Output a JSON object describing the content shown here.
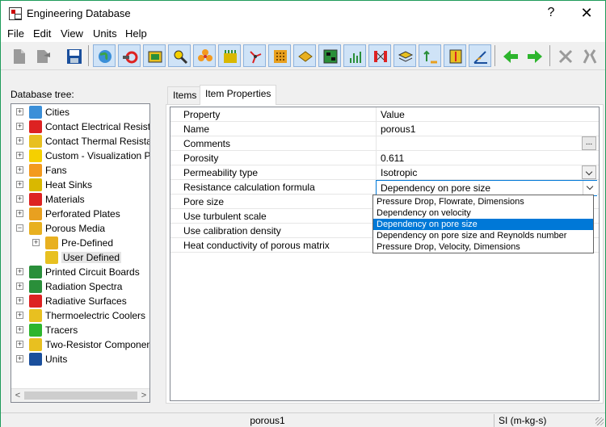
{
  "window": {
    "title": "Engineering Database",
    "help_glyph": "?",
    "close_glyph": "✕"
  },
  "menu": [
    "File",
    "Edit",
    "View",
    "Units",
    "Help"
  ],
  "toolbar_icons": [
    "new-document-icon",
    "open-document-icon",
    "save-icon",
    "globe-icon",
    "contact-electrical-icon",
    "contact-thermal-icon",
    "visualization-icon",
    "fan-icon",
    "heat-sink-icon",
    "materials-icon",
    "perforated-plate-icon",
    "porous-media-icon",
    "pcb-icon",
    "radiation-spectra-icon",
    "radiative-surface-icon",
    "thermoelectric-icon",
    "tracers-icon",
    "two-resistor-icon",
    "units-icon",
    "arrow-left-icon",
    "arrow-right-icon",
    "cut-icon",
    "tools-icon"
  ],
  "tree": {
    "label": "Database tree:",
    "items": [
      {
        "label": "Cities",
        "icon": "globe-icon",
        "level": 0,
        "expander": "+"
      },
      {
        "label": "Contact Electrical Resistan",
        "icon": "contact-electrical-icon",
        "level": 0,
        "expander": "+"
      },
      {
        "label": "Contact Thermal Resistanc",
        "icon": "contact-thermal-icon",
        "level": 0,
        "expander": "+"
      },
      {
        "label": "Custom - Visualization Para",
        "icon": "visualization-icon",
        "level": 0,
        "expander": "+"
      },
      {
        "label": "Fans",
        "icon": "fan-icon",
        "level": 0,
        "expander": "+"
      },
      {
        "label": "Heat Sinks",
        "icon": "heat-sink-icon",
        "level": 0,
        "expander": "+"
      },
      {
        "label": "Materials",
        "icon": "materials-icon",
        "level": 0,
        "expander": "+"
      },
      {
        "label": "Perforated Plates",
        "icon": "perforated-plate-icon",
        "level": 0,
        "expander": "+"
      },
      {
        "label": "Porous Media",
        "icon": "porous-media-icon",
        "level": 0,
        "expander": "−"
      },
      {
        "label": "Pre-Defined",
        "icon": "porous-media-icon",
        "level": 1,
        "expander": "+"
      },
      {
        "label": "User Defined",
        "icon": "user-folder-icon",
        "level": 1,
        "expander": "",
        "selected": true
      },
      {
        "label": "Printed Circuit Boards",
        "icon": "pcb-icon",
        "level": 0,
        "expander": "+"
      },
      {
        "label": "Radiation Spectra",
        "icon": "radiation-spectra-icon",
        "level": 0,
        "expander": "+"
      },
      {
        "label": "Radiative Surfaces",
        "icon": "radiative-surface-icon",
        "level": 0,
        "expander": "+"
      },
      {
        "label": "Thermoelectric Coolers",
        "icon": "thermoelectric-icon",
        "level": 0,
        "expander": "+"
      },
      {
        "label": "Tracers",
        "icon": "tracers-icon",
        "level": 0,
        "expander": "+"
      },
      {
        "label": "Two-Resistor Components",
        "icon": "two-resistor-icon",
        "level": 0,
        "expander": "+"
      },
      {
        "label": "Units",
        "icon": "units-icon",
        "level": 0,
        "expander": "+"
      }
    ],
    "scroll_left": "<",
    "scroll_right": ">"
  },
  "tabs": [
    {
      "label": "Items",
      "active": false
    },
    {
      "label": "Item Properties",
      "active": true
    }
  ],
  "properties": {
    "header": {
      "name": "Property",
      "value": "Value"
    },
    "rows": [
      {
        "name": "Name",
        "value": "porous1"
      },
      {
        "name": "Comments",
        "value": "",
        "button": "..."
      },
      {
        "name": "Porosity",
        "value": "0.611"
      },
      {
        "name": "Permeability type",
        "value": "Isotropic",
        "dropdown": true
      },
      {
        "name": "Resistance calculation formula",
        "value": "Dependency on pore size",
        "dropdown": true,
        "focused": true
      },
      {
        "name": "Pore size",
        "value": ""
      },
      {
        "name": "Use turbulent scale",
        "value": ""
      },
      {
        "name": "Use calibration density",
        "value": ""
      },
      {
        "name": "Heat conductivity of porous matrix",
        "value": ""
      }
    ]
  },
  "dropdown_options": [
    {
      "label": "Pressure Drop, Flowrate, Dimensions",
      "selected": false
    },
    {
      "label": "Dependency on velocity",
      "selected": false
    },
    {
      "label": "Dependency on pore size",
      "selected": true
    },
    {
      "label": "Dependency on pore size and Reynolds number",
      "selected": false
    },
    {
      "label": "Pressure Drop, Velocity, Dimensions",
      "selected": false
    }
  ],
  "status": {
    "left": "porous1",
    "right": "SI (m-kg-s)"
  },
  "colors": {
    "selection": "#0078d7",
    "arrow_green": "#2db52d",
    "window_border": "#1e9b5a"
  }
}
